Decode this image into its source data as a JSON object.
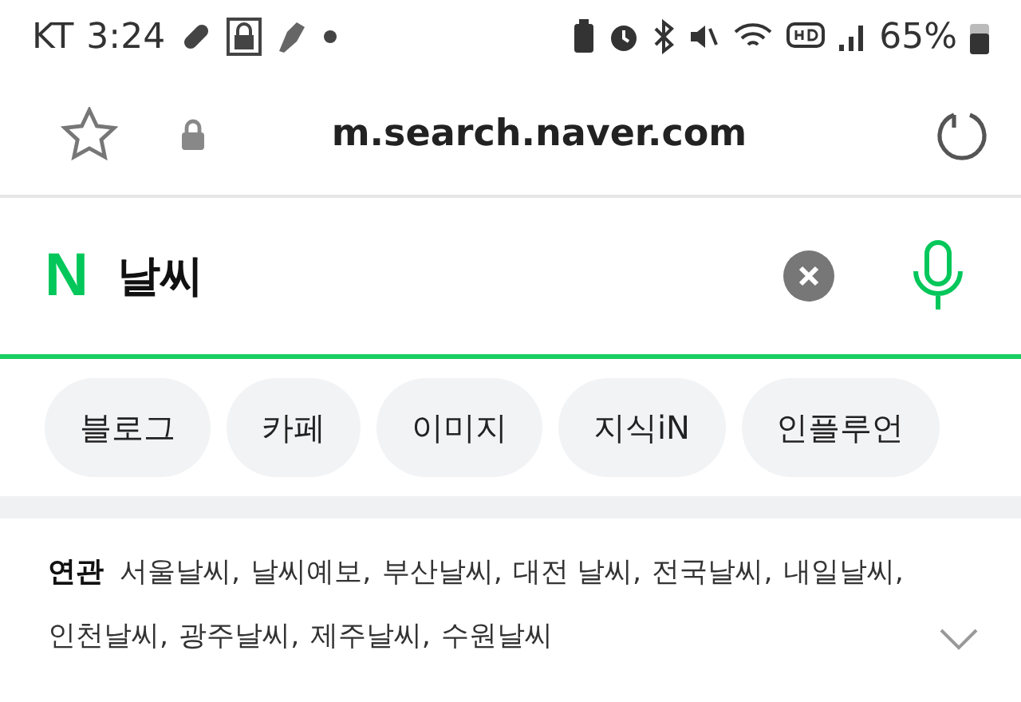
{
  "status_bar": {
    "carrier": "KT",
    "time": "3:24",
    "battery": "65%"
  },
  "address_bar": {
    "url": "m.search.naver.com"
  },
  "search": {
    "logo": "N",
    "value": "날씨"
  },
  "chips": [
    {
      "label": "블로그"
    },
    {
      "label": "카페"
    },
    {
      "label": "이미지"
    },
    {
      "label": "지식iN"
    },
    {
      "label": "인플루언"
    }
  ],
  "related": {
    "label": "연관",
    "items": [
      "서울날씨,",
      "날씨예보,",
      "부산날씨,",
      "대전 날씨,",
      "전국날씨,",
      "내일날씨,",
      "인천날씨,",
      "광주날씨,",
      "제주날씨,",
      "수원날씨"
    ],
    "expanded": false
  }
}
